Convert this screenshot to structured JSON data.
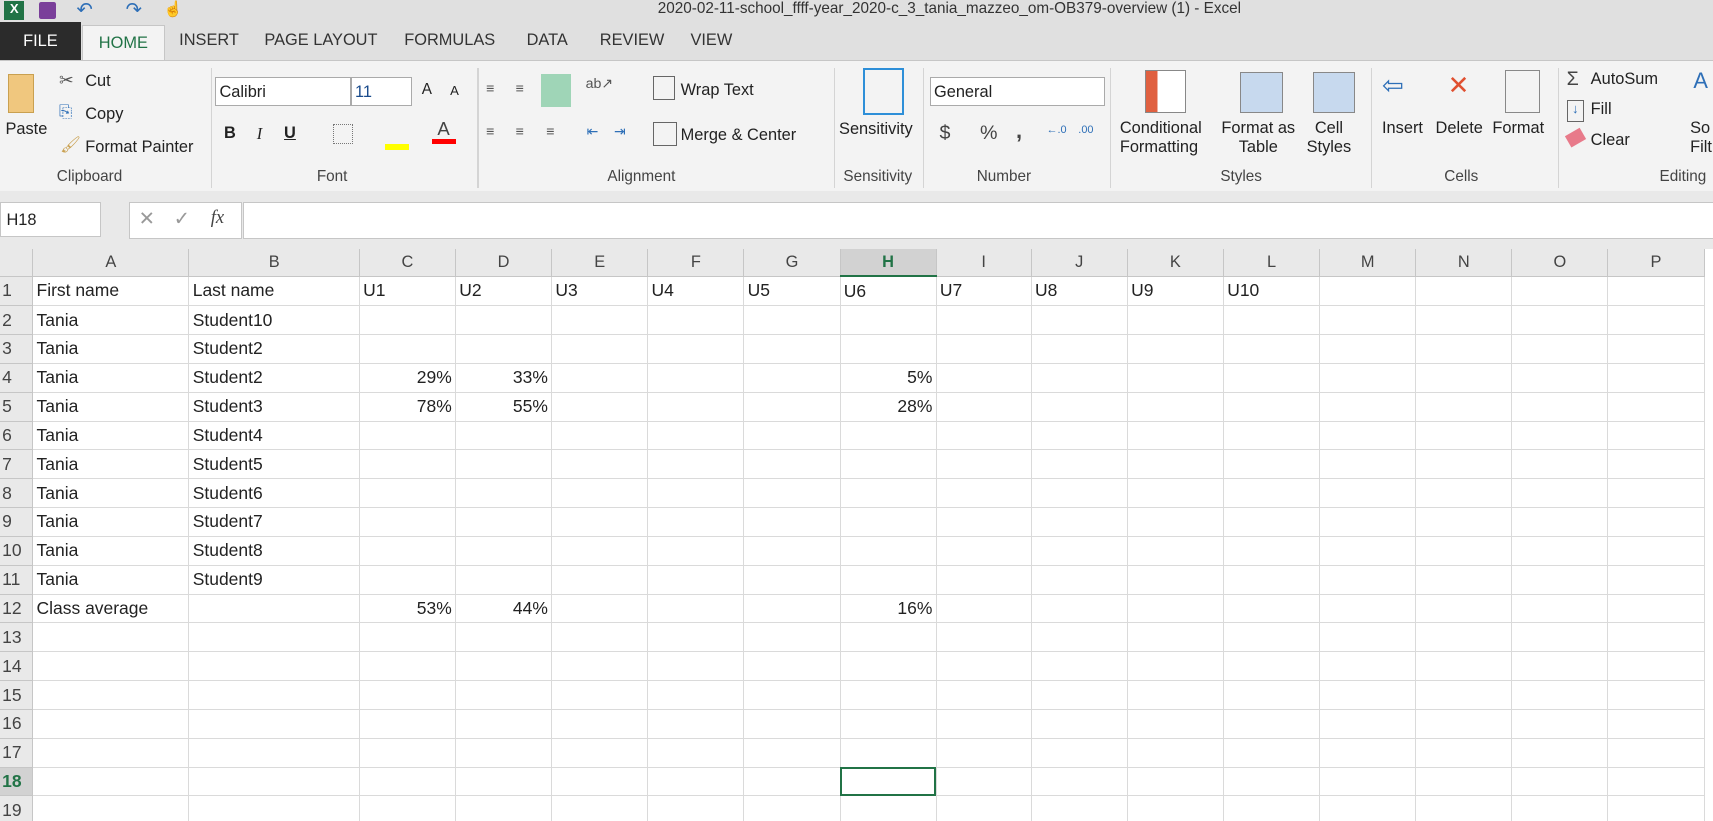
{
  "title": "2020-02-11-school_ffff-year_2020-c_3_tania_mazzeo_om-OB379-overview (1) - Excel",
  "tabs": [
    "FILE",
    "HOME",
    "INSERT",
    "PAGE LAYOUT",
    "FORMULAS",
    "DATA",
    "REVIEW",
    "VIEW"
  ],
  "clipboard": {
    "paste": "Paste",
    "cut": "Cut",
    "copy": "Copy",
    "format_painter": "Format Painter",
    "group": "Clipboard"
  },
  "font": {
    "name": "Calibri",
    "size": "11",
    "bold": "B",
    "italic": "I",
    "underline": "U",
    "group": "Font",
    "highlight_color": "#ffff00",
    "font_color": "#ff0000"
  },
  "alignment": {
    "wrap": "Wrap Text",
    "merge": "Merge & Center",
    "group": "Alignment"
  },
  "sensitivity": {
    "label": "Sensitivity",
    "group": "Sensitivity"
  },
  "number": {
    "format": "General",
    "currency": "$",
    "percent": "%",
    "comma": ",",
    "group": "Number"
  },
  "styles": {
    "conditional1": "Conditional",
    "conditional2": "Formatting",
    "table1": "Format as",
    "table2": "Table",
    "cell1": "Cell",
    "cell2": "Styles",
    "group": "Styles"
  },
  "cells": {
    "insert": "Insert",
    "delete": "Delete",
    "format": "Format",
    "group": "Cells"
  },
  "editing": {
    "autosum": "AutoSum",
    "fill": "Fill",
    "clear": "Clear",
    "sort1": "So",
    "sort2": "Filt",
    "group": "Editing"
  },
  "formula_bar": {
    "name_box": "H18",
    "fx": "fx",
    "value": ""
  },
  "sheet": {
    "columns": [
      "A",
      "B",
      "C",
      "D",
      "E",
      "F",
      "G",
      "H",
      "I",
      "J",
      "K",
      "L",
      "M",
      "N",
      "O",
      "P"
    ],
    "selected_column": "H",
    "selected_row": 18,
    "rows": [
      [
        "First name",
        "Last name",
        "U1",
        "U2",
        "U3",
        "U4",
        "U5",
        "U6",
        "U7",
        "U8",
        "U9",
        "U10",
        "",
        "",
        "",
        ""
      ],
      [
        "Tania",
        "Student10",
        "",
        "",
        "",
        "",
        "",
        "",
        "",
        "",
        "",
        "",
        "",
        "",
        "",
        ""
      ],
      [
        "Tania",
        "Student2",
        "",
        "",
        "",
        "",
        "",
        "",
        "",
        "",
        "",
        "",
        "",
        "",
        "",
        ""
      ],
      [
        "Tania",
        "Student2",
        "29%",
        "33%",
        "",
        "",
        "",
        "5%",
        "",
        "",
        "",
        "",
        "",
        "",
        "",
        ""
      ],
      [
        "Tania",
        "Student3",
        "78%",
        "55%",
        "",
        "",
        "",
        "28%",
        "",
        "",
        "",
        "",
        "",
        "",
        "",
        ""
      ],
      [
        "Tania",
        "Student4",
        "",
        "",
        "",
        "",
        "",
        "",
        "",
        "",
        "",
        "",
        "",
        "",
        "",
        ""
      ],
      [
        "Tania",
        "Student5",
        "",
        "",
        "",
        "",
        "",
        "",
        "",
        "",
        "",
        "",
        "",
        "",
        "",
        ""
      ],
      [
        "Tania",
        "Student6",
        "",
        "",
        "",
        "",
        "",
        "",
        "",
        "",
        "",
        "",
        "",
        "",
        "",
        ""
      ],
      [
        "Tania",
        "Student7",
        "",
        "",
        "",
        "",
        "",
        "",
        "",
        "",
        "",
        "",
        "",
        "",
        "",
        ""
      ],
      [
        "Tania",
        "Student8",
        "",
        "",
        "",
        "",
        "",
        "",
        "",
        "",
        "",
        "",
        "",
        "",
        "",
        ""
      ],
      [
        "Tania",
        "Student9",
        "",
        "",
        "",
        "",
        "",
        "",
        "",
        "",
        "",
        "",
        "",
        "",
        "",
        ""
      ],
      [
        "Class average",
        "",
        "53%",
        "44%",
        "",
        "",
        "",
        "16%",
        "",
        "",
        "",
        "",
        "",
        "",
        "",
        ""
      ],
      [
        "",
        "",
        "",
        "",
        "",
        "",
        "",
        "",
        "",
        "",
        "",
        "",
        "",
        "",
        "",
        ""
      ],
      [
        "",
        "",
        "",
        "",
        "",
        "",
        "",
        "",
        "",
        "",
        "",
        "",
        "",
        "",
        "",
        ""
      ],
      [
        "",
        "",
        "",
        "",
        "",
        "",
        "",
        "",
        "",
        "",
        "",
        "",
        "",
        "",
        "",
        ""
      ],
      [
        "",
        "",
        "",
        "",
        "",
        "",
        "",
        "",
        "",
        "",
        "",
        "",
        "",
        "",
        "",
        ""
      ],
      [
        "",
        "",
        "",
        "",
        "",
        "",
        "",
        "",
        "",
        "",
        "",
        "",
        "",
        "",
        "",
        ""
      ],
      [
        "",
        "",
        "",
        "",
        "",
        "",
        "",
        "",
        "",
        "",
        "",
        "",
        "",
        "",
        "",
        ""
      ],
      [
        "",
        "",
        "",
        "",
        "",
        "",
        "",
        "",
        "",
        "",
        "",
        "",
        "",
        "",
        "",
        ""
      ]
    ]
  }
}
